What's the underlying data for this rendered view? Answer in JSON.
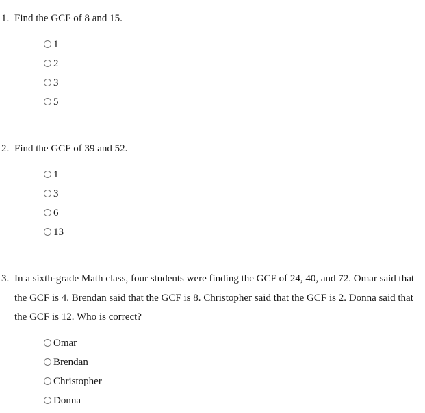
{
  "questions": [
    {
      "number": "1.",
      "text": "Find the GCF of 8 and 15.",
      "options": [
        "1",
        "2",
        "3",
        "5"
      ]
    },
    {
      "number": "2.",
      "text": "Find the GCF of 39 and 52.",
      "options": [
        "1",
        "3",
        "6",
        "13"
      ]
    },
    {
      "number": "3.",
      "text": "In a sixth-grade Math class, four students were finding the GCF of 24, 40, and 72. Omar said that the GCF is 4. Brendan said that the GCF is 8. Christopher said that the GCF is 2. Donna said that the GCF is 12. Who is correct?",
      "options": [
        "Omar",
        "Brendan",
        "Christopher",
        "Donna"
      ]
    }
  ]
}
